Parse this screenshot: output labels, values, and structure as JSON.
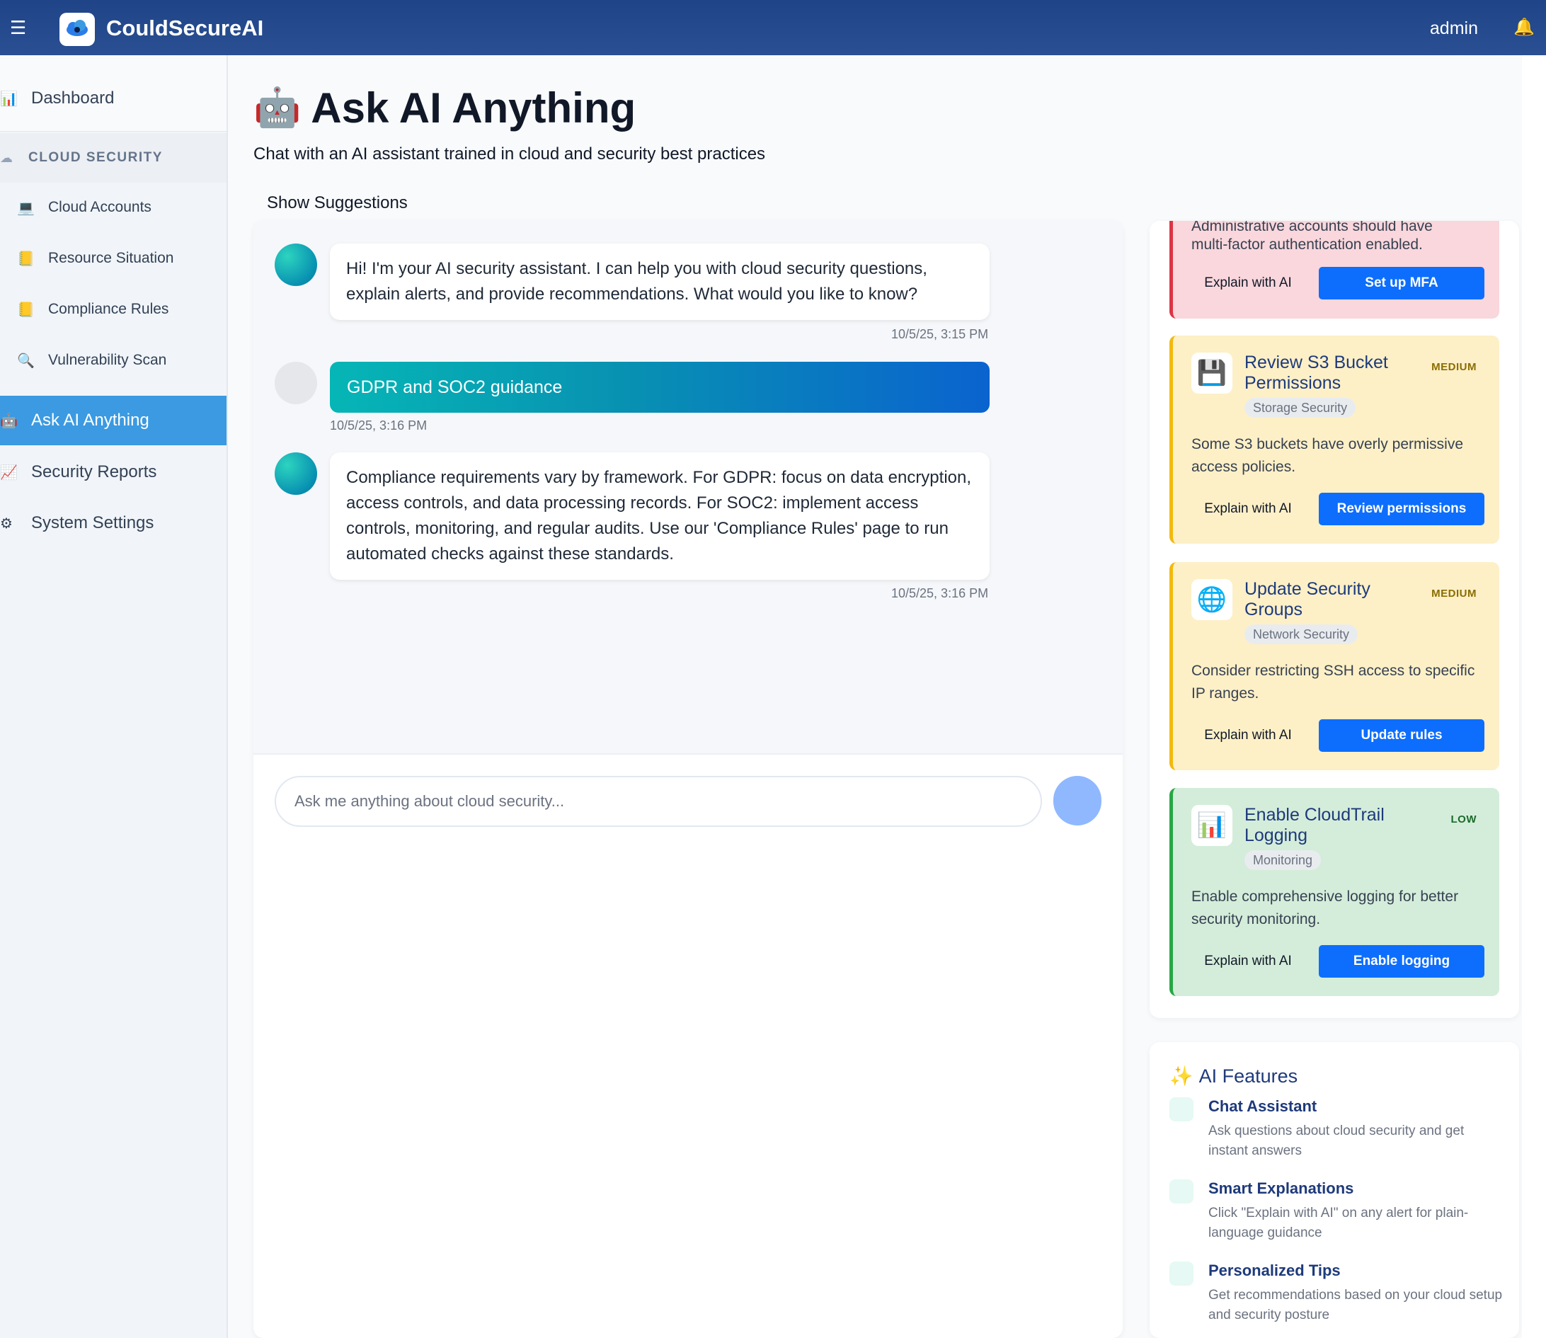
{
  "app": {
    "title": "CouldSecureAI",
    "user": "admin"
  },
  "sidebar": {
    "dashboard": "Dashboard",
    "section": "CLOUD SECURITY",
    "items": [
      {
        "label": "Cloud Accounts"
      },
      {
        "label": "Resource Situation"
      },
      {
        "label": "Compliance Rules"
      },
      {
        "label": "Vulnerability Scan"
      }
    ],
    "ask_ai": "Ask AI Anything",
    "reports": "Security Reports",
    "settings": "System Settings"
  },
  "main": {
    "title": "Ask AI Anything",
    "subtitle": "Chat with an AI assistant trained in cloud and security best practices",
    "show_suggestions": "Show Suggestions"
  },
  "chat": {
    "messages": [
      {
        "role": "ai",
        "text": "Hi! I'm your AI security assistant. I can help you with cloud security questions, explain alerts, and provide recommendations. What would you like to know?",
        "time": "10/5/25, 3:15 PM"
      },
      {
        "role": "user",
        "text": "GDPR and SOC2 guidance",
        "time": "10/5/25, 3:16 PM"
      },
      {
        "role": "ai",
        "text": "Compliance requirements vary by framework. For GDPR: focus on data encryption, access controls, and data processing records. For SOC2: implement access controls, monitoring, and regular audits. Use our 'Compliance Rules' page to run automated checks against these standards.",
        "time": "10/5/25, 3:16 PM"
      }
    ],
    "input_placeholder": "Ask me anything about cloud security..."
  },
  "suggestions": {
    "partial": {
      "desc_cut": "Administrative accounts should have",
      "desc": "multi-factor authentication enabled.",
      "explain": "Explain with AI",
      "action": "Set up MFA"
    },
    "cards": [
      {
        "title": "Review S3 Bucket Permissions",
        "severity": "MEDIUM",
        "tag": "Storage Security",
        "desc": "Some S3 buckets have overly permissive access policies.",
        "explain": "Explain with AI",
        "action": "Review permissions",
        "icon": "floppy-icon"
      },
      {
        "title": "Update Security Groups",
        "severity": "MEDIUM",
        "tag": "Network Security",
        "desc": "Consider restricting SSH access to specific IP ranges.",
        "explain": "Explain with AI",
        "action": "Update rules",
        "icon": "globe-icon"
      },
      {
        "title": "Enable CloudTrail Logging",
        "severity": "LOW",
        "tag": "Monitoring",
        "desc": "Enable comprehensive logging for better security monitoring.",
        "explain": "Explain with AI",
        "action": "Enable logging",
        "icon": "bar-chart-icon"
      }
    ]
  },
  "features": {
    "heading": "AI Features",
    "items": [
      {
        "title": "Chat Assistant",
        "desc": "Ask questions about cloud security and get instant answers"
      },
      {
        "title": "Smart Explanations",
        "desc": "Click \"Explain with AI\" on any alert for plain-language guidance"
      },
      {
        "title": "Personalized Tips",
        "desc": "Get recommendations based on your cloud setup and security posture"
      }
    ]
  },
  "colors": {
    "header": "#1f4487",
    "accent": "#3b9ae1",
    "primary_button": "#0d6efd"
  }
}
